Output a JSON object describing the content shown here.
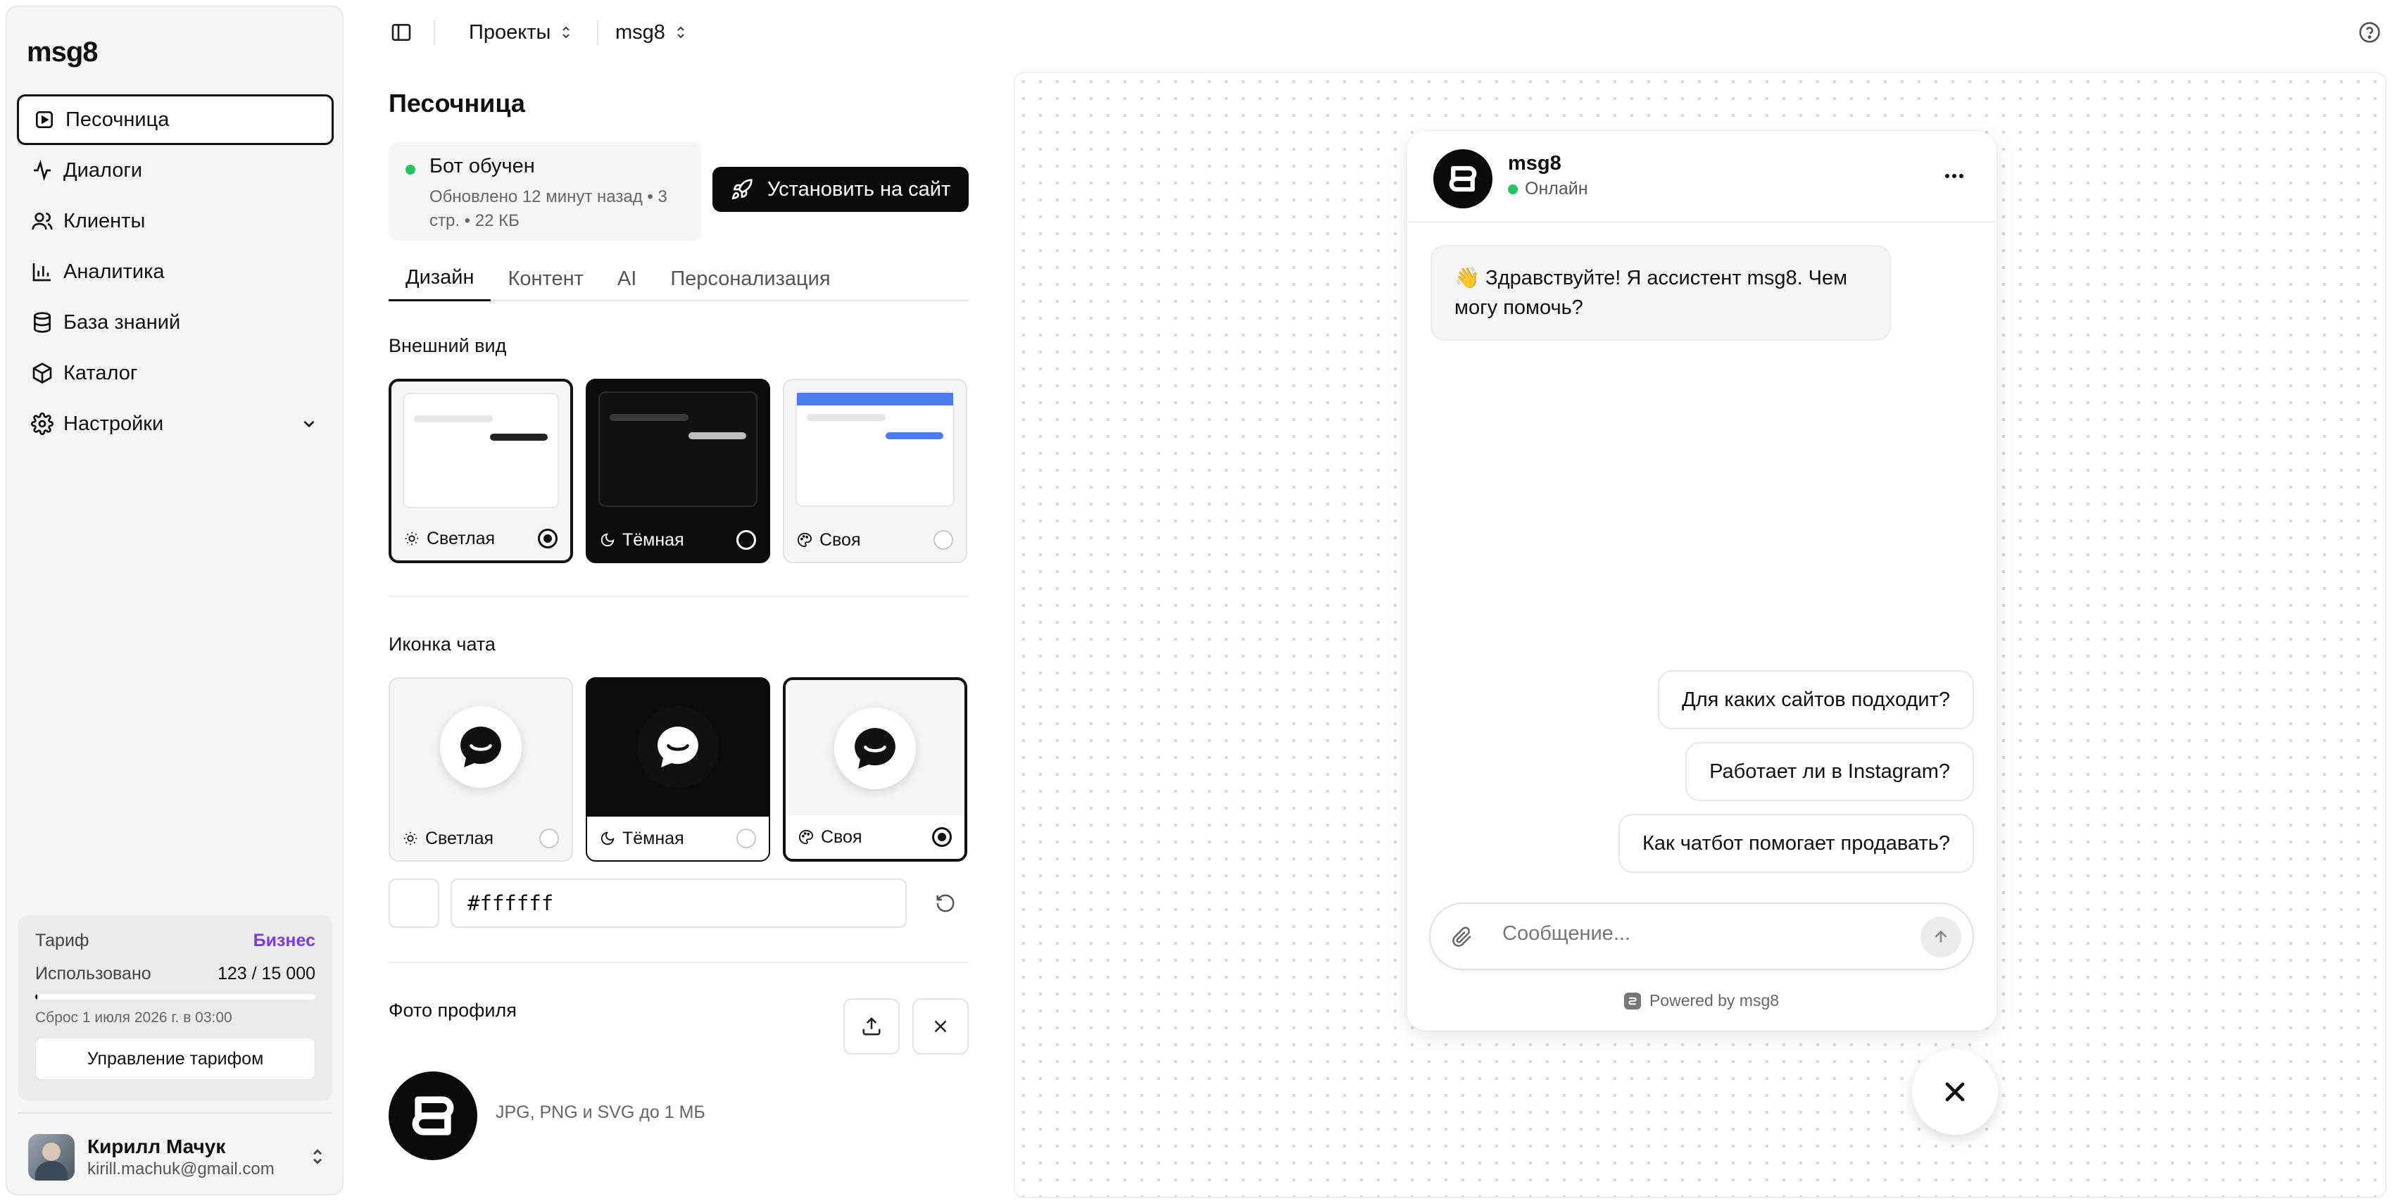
{
  "app": {
    "logo": "msg8"
  },
  "sidebar": {
    "items": [
      {
        "label": "Песочница",
        "icon": "sandbox-icon",
        "active": true
      },
      {
        "label": "Диалоги",
        "icon": "activity-icon"
      },
      {
        "label": "Клиенты",
        "icon": "users-icon"
      },
      {
        "label": "Аналитика",
        "icon": "chart-icon"
      },
      {
        "label": "База знаний",
        "icon": "database-icon"
      },
      {
        "label": "Каталог",
        "icon": "package-icon"
      },
      {
        "label": "Настройки",
        "icon": "gear-icon",
        "has_submenu": true
      }
    ],
    "plan": {
      "label": "Тариф",
      "name": "Бизнес",
      "used_label": "Использовано",
      "used_value": "123 / 15 000",
      "used_fraction": 0.0082,
      "reset": "Сброс 1 июля 2026 г. в 03:00",
      "manage_button": "Управление тарифом"
    },
    "user": {
      "name": "Кирилл Мачук",
      "email": "kirill.machuk@gmail.com"
    }
  },
  "topbar": {
    "projects_label": "Проекты",
    "project_name": "msg8"
  },
  "main": {
    "title": "Песочница",
    "status": {
      "title": "Бот обучен",
      "subtitle": "Обновлено 12 минут назад • 3 стр. • 22 КБ",
      "color": "#22c55e"
    },
    "install_button": "Установить на сайт",
    "tabs": [
      {
        "label": "Дизайн",
        "active": true
      },
      {
        "label": "Контент"
      },
      {
        "label": "AI"
      },
      {
        "label": "Персонализация"
      }
    ],
    "appearance": {
      "label": "Внешний вид",
      "options": [
        {
          "label": "Светлая",
          "icon": "sun-icon",
          "selected": true
        },
        {
          "label": "Тёмная",
          "icon": "moon-icon",
          "selected": false
        },
        {
          "label": "Своя",
          "icon": "palette-icon",
          "selected": false
        }
      ]
    },
    "chat_icon": {
      "label": "Иконка чата",
      "options": [
        {
          "label": "Светлая",
          "icon": "sun-icon",
          "selected": false
        },
        {
          "label": "Тёмная",
          "icon": "moon-icon",
          "selected": false
        },
        {
          "label": "Своя",
          "icon": "palette-icon",
          "selected": true
        }
      ],
      "color_value": "#ffffff"
    },
    "profile_photo": {
      "label": "Фото профиля",
      "hint": "JPG, PNG и SVG до 1 МБ"
    }
  },
  "preview": {
    "bot_name": "msg8",
    "bot_status": "Онлайн",
    "greeting": "👋 Здравствуйте! Я ассистент msg8. Чем могу помочь?",
    "suggestions": [
      "Для каких сайтов подходит?",
      "Работает ли в Instagram?",
      "Как чатбот помогает продавать?"
    ],
    "input_placeholder": "Сообщение...",
    "powered_by": "Powered by msg8"
  },
  "colors": {
    "accent": "#111111",
    "plan_badge": "#7c3aed",
    "online": "#22c55e"
  }
}
